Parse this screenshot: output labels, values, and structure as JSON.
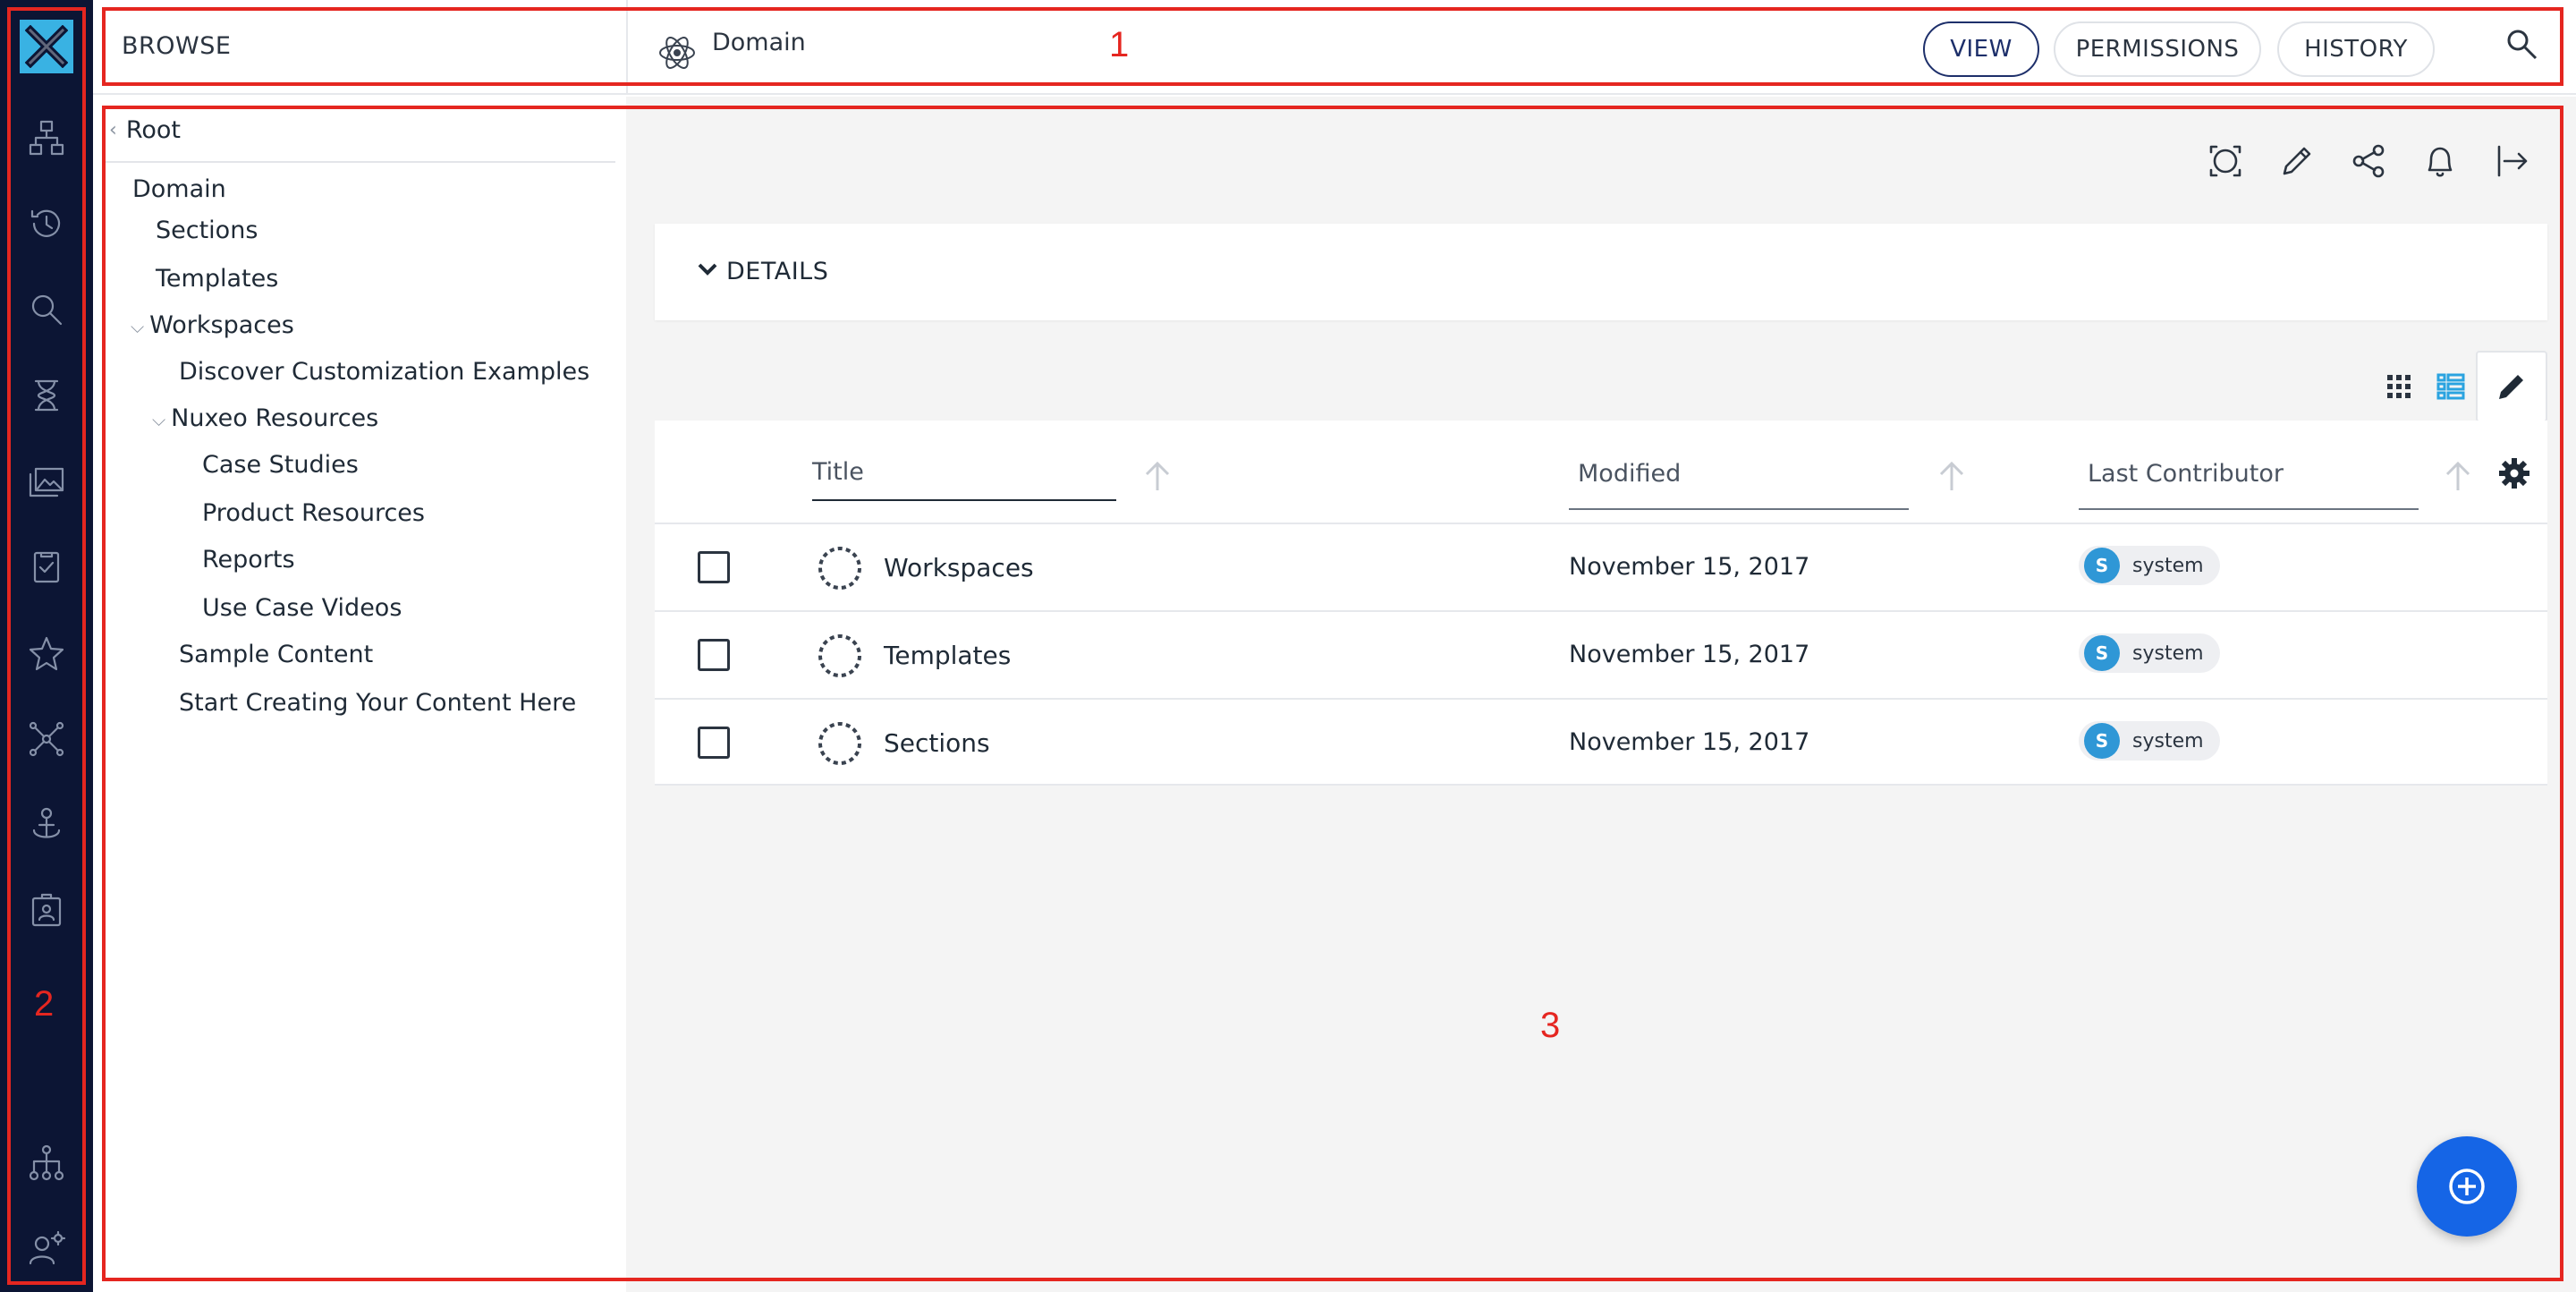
{
  "topbar": {
    "browse_label": "BROWSE",
    "document_title": "Domain",
    "tabs": [
      {
        "label": "VIEW",
        "active": true
      },
      {
        "label": "PERMISSIONS",
        "active": false
      },
      {
        "label": "HISTORY",
        "active": false
      }
    ]
  },
  "rail": {
    "logo": "nuxeo-x-logo",
    "items": [
      "browse-tree-icon",
      "history-icon",
      "search-icon",
      "hourglass-icon",
      "gallery-icon",
      "tasks-icon",
      "star-icon",
      "network-icon",
      "anchor-user-icon",
      "badge-icon"
    ],
    "bottom_items": [
      "hierarchy-icon",
      "user-settings-icon"
    ]
  },
  "tree": {
    "root_label": "Root",
    "items": [
      {
        "label": "Domain",
        "level": 0,
        "expandable": false
      },
      {
        "label": "Sections",
        "level": 1,
        "expandable": false
      },
      {
        "label": "Templates",
        "level": 1,
        "expandable": false
      },
      {
        "label": "Workspaces",
        "level": 1,
        "expandable": true
      },
      {
        "label": "Discover Customization Examples",
        "level": 2,
        "expandable": false
      },
      {
        "label": "Nuxeo Resources",
        "level": 2,
        "expandable": true
      },
      {
        "label": "Case Studies",
        "level": 3,
        "expandable": false
      },
      {
        "label": "Product Resources",
        "level": 3,
        "expandable": false
      },
      {
        "label": "Reports",
        "level": 3,
        "expandable": false
      },
      {
        "label": "Use Case Videos",
        "level": 3,
        "expandable": false
      },
      {
        "label": "Sample Content",
        "level": 2,
        "expandable": false
      },
      {
        "label": "Start Creating Your Content Here",
        "level": 2,
        "expandable": false
      }
    ]
  },
  "main": {
    "details_label": "DETAILS",
    "actions": [
      "preview-icon",
      "edit-icon",
      "share-icon",
      "notification-bell-icon",
      "export-icon"
    ],
    "table": {
      "columns": [
        "Title",
        "Modified",
        "Last Contributor"
      ],
      "rows": [
        {
          "title": "Workspaces",
          "modified": "November 15, 2017",
          "contributor": "system",
          "initial": "S"
        },
        {
          "title": "Templates",
          "modified": "November 15, 2017",
          "contributor": "system",
          "initial": "S"
        },
        {
          "title": "Sections",
          "modified": "November 15, 2017",
          "contributor": "system",
          "initial": "S"
        }
      ]
    }
  },
  "annotations": [
    "1",
    "2",
    "3"
  ],
  "colors": {
    "rail_bg": "#0c1534",
    "logo_bg": "#39b2e3",
    "accent": "#1565e6",
    "annotation": "#e52620",
    "avatar": "#2f97d6"
  }
}
